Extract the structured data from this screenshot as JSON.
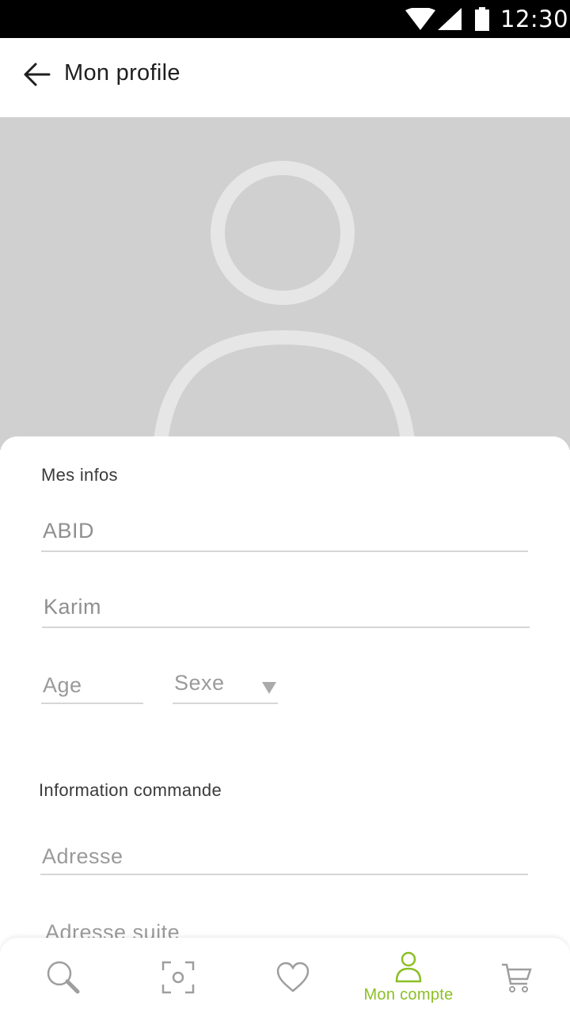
{
  "status_bar": {
    "time": "12:30"
  },
  "app_bar": {
    "title": "Mon profile"
  },
  "profile": {
    "section_title": "Mes infos",
    "last_name": "ABID",
    "first_name": "Karim",
    "age_placeholder": "Age",
    "sex_placeholder": "Sexe"
  },
  "order": {
    "section_title": "Information commande",
    "address_placeholder": "Adresse",
    "address2_placeholder": "Adresse suite"
  },
  "bottom_nav": {
    "items": [
      {
        "icon": "search-icon"
      },
      {
        "icon": "scan-icon"
      },
      {
        "icon": "heart-icon"
      },
      {
        "icon": "user-icon",
        "label": "Mon compte",
        "active": true
      },
      {
        "icon": "cart-icon"
      }
    ],
    "active_color": "#8cbf26",
    "inactive_color": "#9e9e9e"
  },
  "colors": {
    "accent": "#8cbf26",
    "hero_bg": "#d0d0d0"
  }
}
